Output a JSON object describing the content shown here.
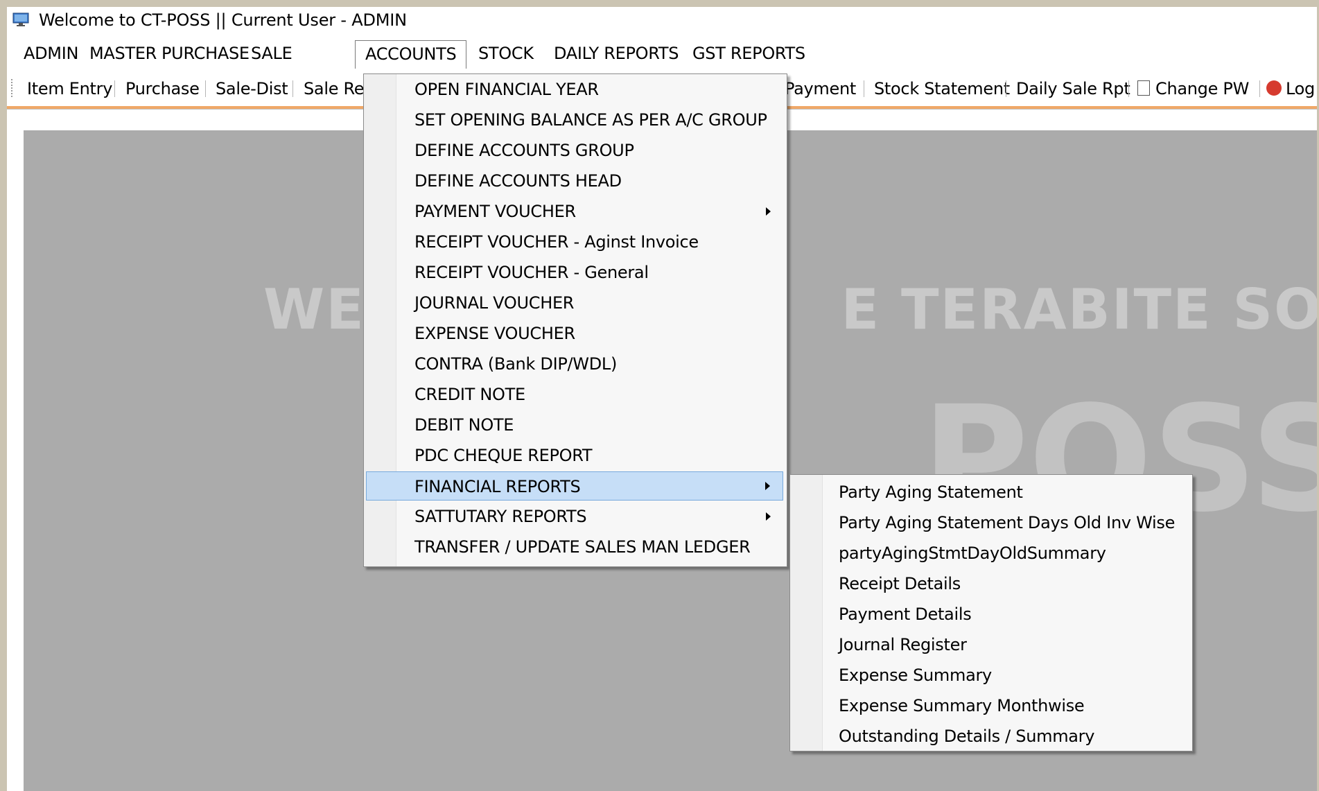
{
  "window": {
    "title": "Welcome to CT-POSS || Current User - ADMIN"
  },
  "menubar": {
    "items": [
      {
        "label": "ADMIN"
      },
      {
        "label": "MASTER"
      },
      {
        "label": "PURCHASE"
      },
      {
        "label": "SALE"
      },
      {
        "label": "ACCOUNTS"
      },
      {
        "label": "STOCK"
      },
      {
        "label": "DAILY REPORTS"
      },
      {
        "label": "GST REPORTS"
      }
    ],
    "active": "ACCOUNTS"
  },
  "toolbar": {
    "items": [
      {
        "label": "Item Entry"
      },
      {
        "label": "Purchase"
      },
      {
        "label": "Sale-Dist"
      },
      {
        "label": "Sale Re"
      },
      {
        "label": "Payment"
      },
      {
        "label": "Stock Statement"
      },
      {
        "label": "Daily Sale Rpt"
      },
      {
        "label": "Change PW"
      },
      {
        "label": "Log"
      }
    ]
  },
  "background": {
    "watermark_line1": "WE                       E TERABITE SOLUTION",
    "watermark_line2": "POSS"
  },
  "accounts_menu": {
    "items": [
      {
        "label": "OPEN FINANCIAL YEAR",
        "has_submenu": false
      },
      {
        "label": "SET OPENING BALANCE AS PER A/C GROUP",
        "has_submenu": false
      },
      {
        "label": "DEFINE ACCOUNTS GROUP",
        "has_submenu": false
      },
      {
        "label": "DEFINE ACCOUNTS HEAD",
        "has_submenu": false
      },
      {
        "label": "PAYMENT VOUCHER",
        "has_submenu": true
      },
      {
        "label": "RECEIPT VOUCHER - Aginst Invoice",
        "has_submenu": false
      },
      {
        "label": "RECEIPT VOUCHER - General",
        "has_submenu": false
      },
      {
        "label": "JOURNAL VOUCHER",
        "has_submenu": false
      },
      {
        "label": "EXPENSE VOUCHER",
        "has_submenu": false
      },
      {
        "label": "CONTRA (Bank DIP/WDL)",
        "has_submenu": false
      },
      {
        "label": "CREDIT NOTE",
        "has_submenu": false
      },
      {
        "label": "DEBIT NOTE",
        "has_submenu": false
      },
      {
        "label": "PDC CHEQUE REPORT",
        "has_submenu": false
      },
      {
        "label": "FINANCIAL REPORTS",
        "has_submenu": true,
        "selected": true
      },
      {
        "label": "SATTUTARY REPORTS",
        "has_submenu": true
      },
      {
        "label": "TRANSFER / UPDATE SALES MAN LEDGER",
        "has_submenu": false
      }
    ]
  },
  "financial_reports_submenu": {
    "items": [
      {
        "label": "Party Aging Statement"
      },
      {
        "label": "Party Aging Statement Days Old Inv Wise"
      },
      {
        "label": "partyAgingStmtDayOldSummary"
      },
      {
        "label": "Receipt Details"
      },
      {
        "label": "Payment Details"
      },
      {
        "label": "Journal Register"
      },
      {
        "label": "Expense Summary"
      },
      {
        "label": "Expense Summary Monthwise"
      },
      {
        "label": "Outstanding Details / Summary"
      }
    ]
  },
  "colors": {
    "selection_bg": "#c6def7",
    "selection_border": "#76a9dc",
    "toolbar_accent": "#f0a868",
    "content_bg": "#ababab"
  },
  "icons": {
    "app": "monitor-icon",
    "change_pw": "document-icon",
    "logout": "power-icon",
    "submenu_arrow": "chevron-right-icon"
  }
}
